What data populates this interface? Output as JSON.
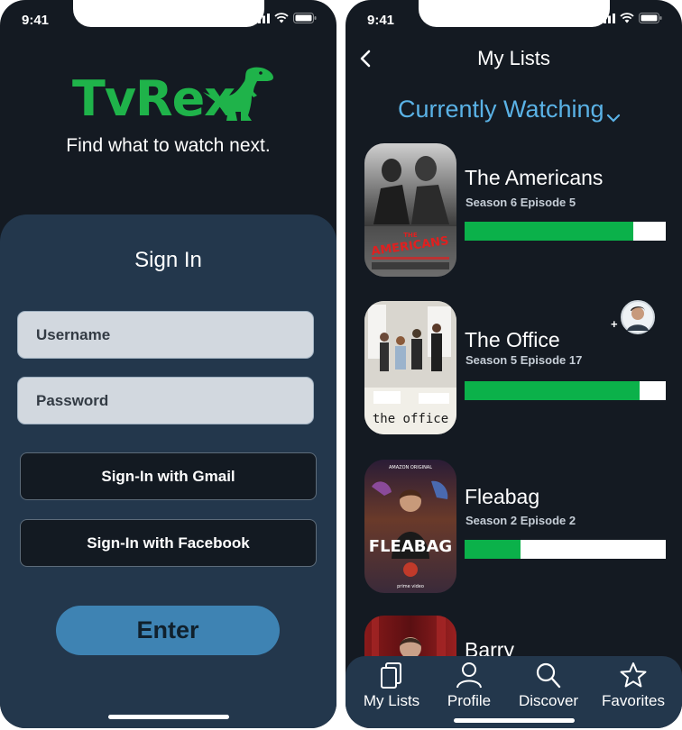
{
  "status_time": "9:41",
  "signin_screen": {
    "logo": "TvRex",
    "tagline": "Find what to watch next.",
    "title": "Sign In",
    "username_placeholder": "Username",
    "password_placeholder": "Password",
    "gmail_label": "Sign-In with Gmail",
    "facebook_label": "Sign-In with Facebook",
    "enter_label": "Enter"
  },
  "lists_screen": {
    "title": "My Lists",
    "selected_list": "Currently Watching",
    "shows": [
      {
        "title": "The Americans",
        "episode": "Season 6 Episode 5",
        "progress": 0.84,
        "poster_text": "THE AMERICANS"
      },
      {
        "title": "The Office",
        "episode": "Season 5 Episode 17",
        "progress": 0.87,
        "poster_text": "the office"
      },
      {
        "title": "Fleabag",
        "episode": "Season 2 Episode 2",
        "progress": 0.28,
        "poster_text": "FLEABAG"
      },
      {
        "title": "Barry",
        "episode": "",
        "progress": 0,
        "poster_text": ""
      }
    ],
    "tabs": [
      {
        "label": "My Lists",
        "icon": "cards-icon"
      },
      {
        "label": "Profile",
        "icon": "person-icon"
      },
      {
        "label": "Discover",
        "icon": "search-icon"
      },
      {
        "label": "Favorites",
        "icon": "star-icon"
      }
    ]
  },
  "colors": {
    "background": "#141a22",
    "panel": "#23374c",
    "brand_green": "#1fb34a",
    "progress_green": "#0bb14a",
    "accent_blue": "#5ab2e6",
    "enter_button": "#3e83b3"
  }
}
